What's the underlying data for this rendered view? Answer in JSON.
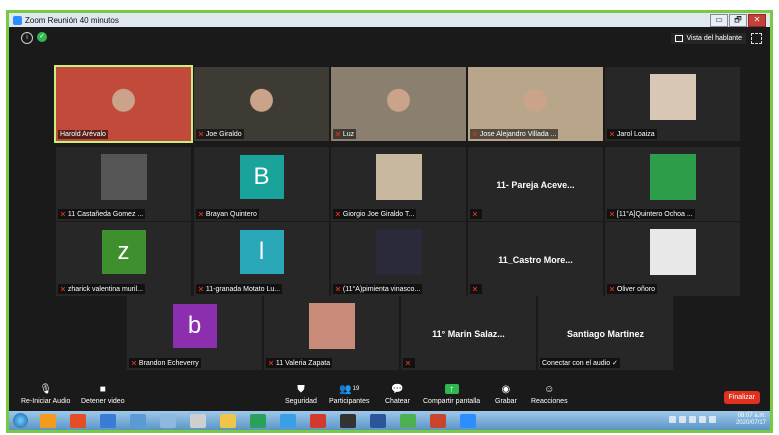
{
  "window": {
    "title": "Zoom Reunión 40 minutos",
    "min": "▭",
    "max": "🗗",
    "close": "✕"
  },
  "meeting": {
    "speaker_view_label": "Vista del hablante"
  },
  "tiles": [
    {
      "name": "Harold Arévalo",
      "kind": "camera",
      "muted": false,
      "active": true,
      "bg": "#c24a3a"
    },
    {
      "name": "Joe Giraldo",
      "kind": "camera",
      "muted": true,
      "bg": "#3e3a34"
    },
    {
      "name": "Luz",
      "kind": "camera",
      "muted": true,
      "bg": "#8b8070"
    },
    {
      "name": "Jose Alejandro Villada ...",
      "kind": "camera",
      "muted": true,
      "bg": "#b9a68a"
    },
    {
      "name": "Jarol Loaiza",
      "kind": "photo",
      "muted": true,
      "bg": "#d9c7b5"
    },
    {
      "name": "11 Castañeda Gomez ...",
      "kind": "photo",
      "muted": true,
      "bg": "#555555"
    },
    {
      "name": "Brayan Quintero",
      "kind": "letter",
      "letter": "B",
      "muted": true,
      "color": "#1aa39a"
    },
    {
      "name": "Giorgio Joe Giraldo T...",
      "kind": "photo",
      "muted": true,
      "bg": "#c9b8a0"
    },
    {
      "name": "",
      "kind": "bigname",
      "title": "11- Pareja Aceve...",
      "muted": true
    },
    {
      "name": "[11°A]Quintero Ochoa ...",
      "kind": "photo",
      "muted": true,
      "bg": "#2e9d4a"
    },
    {
      "name": "zharick valentina muril...",
      "kind": "letter",
      "letter": "z",
      "muted": true,
      "color": "#3f8f2e"
    },
    {
      "name": "11-granada Motato Lu...",
      "kind": "letter",
      "letter": "l",
      "muted": true,
      "color": "#2aa7b8"
    },
    {
      "name": "(11°A)pimienta vinasco...",
      "kind": "photo",
      "muted": true,
      "bg": "#2a2a3a"
    },
    {
      "name": "",
      "kind": "bigname",
      "title": "11_Castro More...",
      "muted": true
    },
    {
      "name": "Oliver oñoro",
      "kind": "photo",
      "muted": true,
      "bg": "#e8e8e8"
    },
    {
      "name": "Brandon Echeverry",
      "kind": "letter",
      "letter": "b",
      "muted": true,
      "color": "#8b2fae"
    },
    {
      "name": "11 Valeria Zapata",
      "kind": "photo",
      "muted": true,
      "bg": "#c98a7a"
    },
    {
      "name": "",
      "kind": "bigname",
      "title": "11° Marin  Salaz...",
      "muted": true
    },
    {
      "name": "Conectar con el audio ✓",
      "kind": "bigname",
      "title": "Santiago Martinez",
      "muted": false
    }
  ],
  "toolbar": {
    "audio": "Re-Iniciar Audio",
    "video": "Detener video",
    "security": "Seguridad",
    "participants": "Participantes",
    "participants_count": "19",
    "chat": "Chatear",
    "share": "Compartir pantalla",
    "record": "Grabar",
    "reactions": "Reacciones",
    "end": "Finalizar"
  },
  "taskbar": {
    "time": "08:07 a.m.",
    "date": "2020/07/17",
    "lang": "ES"
  },
  "colors": {
    "frame_border": "#7ac943",
    "end_button": "#e0301e",
    "share_green": "#2fb84f"
  }
}
